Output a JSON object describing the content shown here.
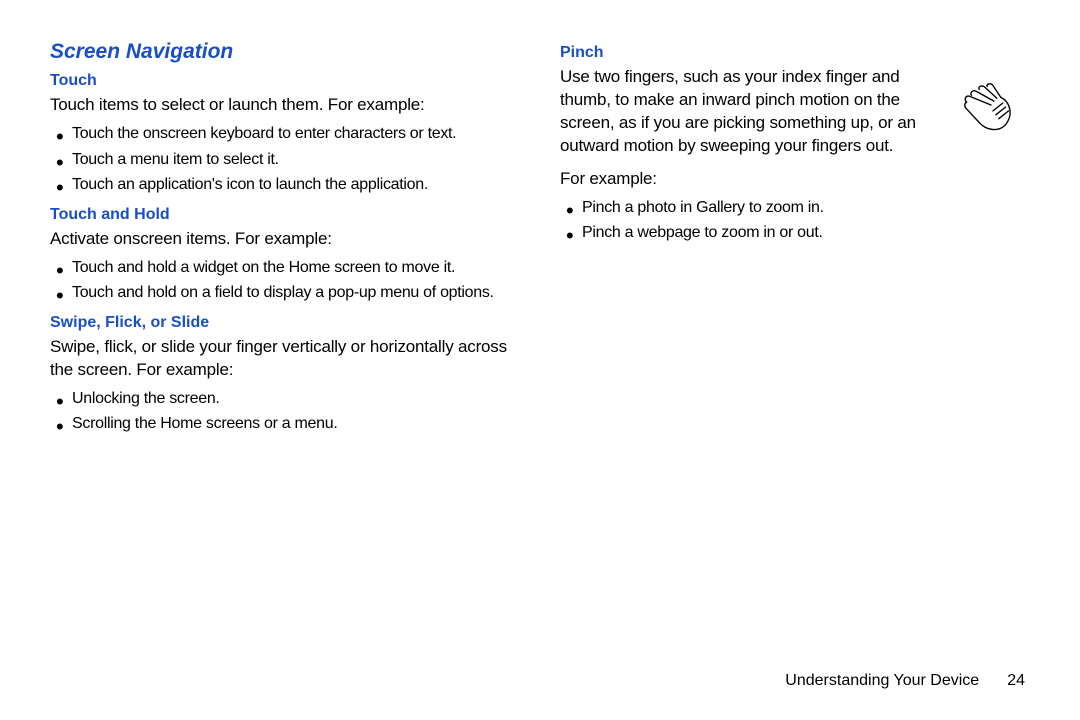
{
  "page": {
    "title": "Screen Navigation",
    "left": {
      "touch": {
        "heading": "Touch",
        "intro": "Touch items to select or launch them. For example:",
        "items": [
          "Touch the onscreen keyboard to enter characters or text.",
          "Touch a menu item to select it.",
          "Touch an application's icon to launch the application."
        ]
      },
      "touchHold": {
        "heading": "Touch and Hold",
        "intro": "Activate onscreen items. For example:",
        "items": [
          "Touch and hold a widget on the Home screen to move it.",
          "Touch and hold on a field to display a pop-up menu of options."
        ]
      },
      "swipe": {
        "heading": "Swipe, Flick, or Slide",
        "intro": "Swipe, flick, or slide your finger vertically or horizontally across the screen. For example:",
        "items": [
          "Unlocking the screen.",
          "Scrolling the Home screens or a menu."
        ]
      }
    },
    "right": {
      "pinch": {
        "heading": "Pinch",
        "para": "Use two fingers, such as your index finger and thumb, to make an inward pinch motion on the screen, as if you are picking something up, or an outward motion by sweeping your fingers out.",
        "example_label": "For example:",
        "items": [
          "Pinch a photo in Gallery to zoom in.",
          "Pinch a webpage to zoom in or out."
        ]
      }
    },
    "footer": {
      "label": "Understanding Your Device",
      "page_num": "24"
    }
  }
}
